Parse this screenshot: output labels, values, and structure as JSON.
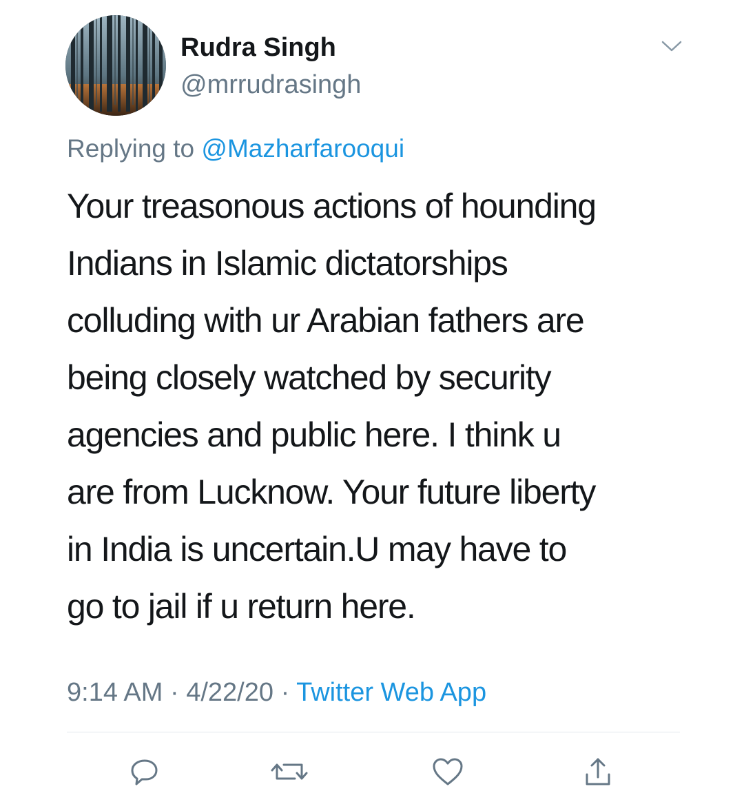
{
  "tweet": {
    "display_name": "Rudra Singh",
    "handle": "@mrrudrasingh",
    "replying_prefix": "Replying to",
    "replying_to": "@Mazharfarooqui",
    "text_lines": [
      "Your treasonous actions of hounding",
      "Indians in Islamic dictatorships",
      "colluding with ur Arabian fathers are",
      "being closely watched by security",
      "agencies and public here. I think u",
      "are from Lucknow. Your future liberty",
      "in India is uncertain.U may have to",
      "go to jail if u return here."
    ],
    "time": "9:14 AM",
    "separator": "·",
    "date": "4/22/20",
    "source": "Twitter Web App"
  },
  "icons": {
    "menu": "chevron-down-icon",
    "reply": "reply-icon",
    "retweet": "retweet-icon",
    "like": "heart-icon",
    "share": "share-icon"
  },
  "colors": {
    "text": "#14171a",
    "secondary": "#657786",
    "link": "#1b95e0",
    "divider": "#e1e8ed"
  }
}
